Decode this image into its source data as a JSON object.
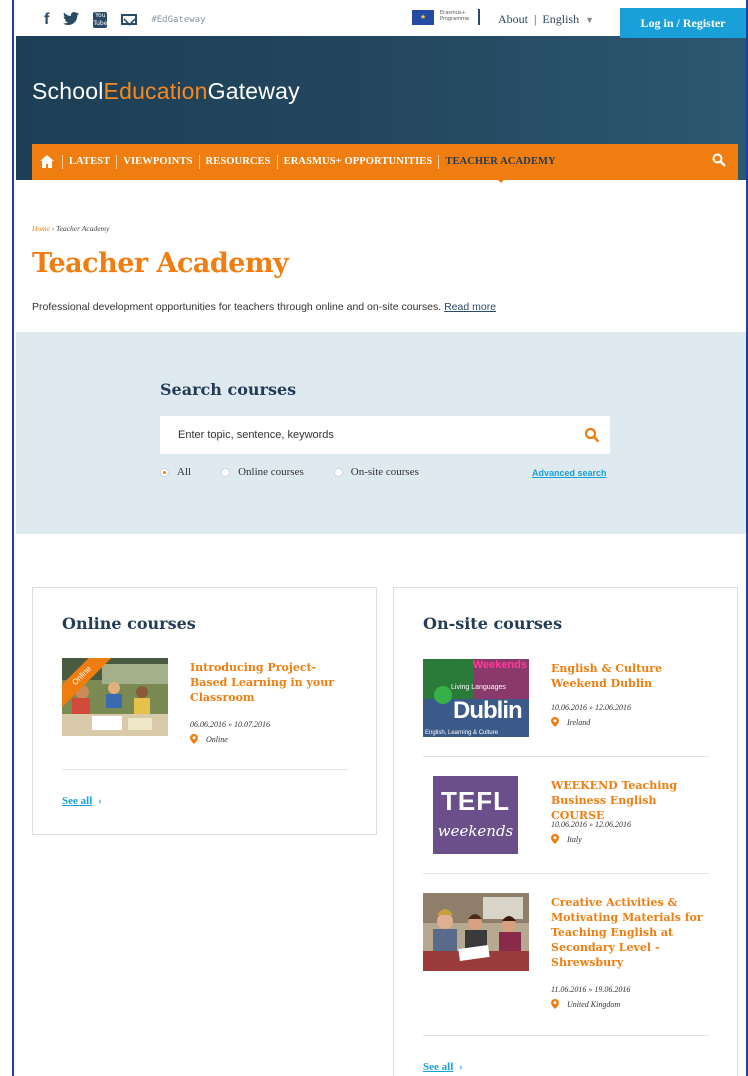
{
  "topbar": {
    "social_icons": [
      "facebook-icon",
      "twitter-icon",
      "youtube-icon",
      "mail-icon"
    ],
    "youtube_text": "You Tube",
    "hashtag": "#EdGateway",
    "eu_text": "Erasmus+ Programme",
    "about": "About",
    "separator": "|",
    "language": "English",
    "login": "Log in / Register"
  },
  "logo": {
    "part1": "School",
    "part2": "Education",
    "part3": "Gateway"
  },
  "nav": {
    "items": [
      "LATEST",
      "VIEWPOINTS",
      "RESOURCES",
      "ERASMUS+ OPPORTUNITIES",
      "TEACHER ACADEMY"
    ],
    "active": "TEACHER ACADEMY"
  },
  "breadcrumb": {
    "home": "Home",
    "sep": " › ",
    "current": "Teacher Academy"
  },
  "page": {
    "title": "Teacher Academy",
    "intro": "Professional development opportunities for teachers through online and on-site courses.",
    "read_more": "Read more"
  },
  "search": {
    "title": "Search courses",
    "placeholder": "Enter topic, sentence, keywords",
    "radios": [
      "All",
      "Online courses",
      "On-site courses"
    ],
    "selected": "All",
    "advanced": "Advanced search"
  },
  "online": {
    "heading": "Online courses",
    "ribbon": "Online",
    "courses": [
      {
        "title": "Introducing Project-Based Learning in your Classroom",
        "dates": "06.06.2016 » 10.07.2016",
        "location": "Online"
      }
    ],
    "see_all": "See all"
  },
  "onsite": {
    "heading": "On-site courses",
    "courses": [
      {
        "title": "English & Culture Weekend Dublin",
        "dates": "10.06.2016 » 12.06.2016",
        "location": "Ireland",
        "thumb_text": [
          "Weekends",
          "Living Languages",
          "Dublin",
          "English, Learning & Culture"
        ]
      },
      {
        "title": "WEEKEND Teaching Business English COURSE",
        "dates": "10.06.2016 » 12.06.2016",
        "location": "Italy",
        "thumb_text": [
          "TEFL",
          "weekends"
        ]
      },
      {
        "title": "Creative Activities & Motivating Materials for Teaching English at Secondary Level - Shrewsbury",
        "dates": "11.06.2016 » 19.06.2016",
        "location": "United Kingdom"
      }
    ],
    "see_all": "See all"
  },
  "colors": {
    "orange": "#ef7d0f",
    "navy": "#243c55",
    "blue": "#1aa0d8",
    "band": "#dfe9f0"
  }
}
